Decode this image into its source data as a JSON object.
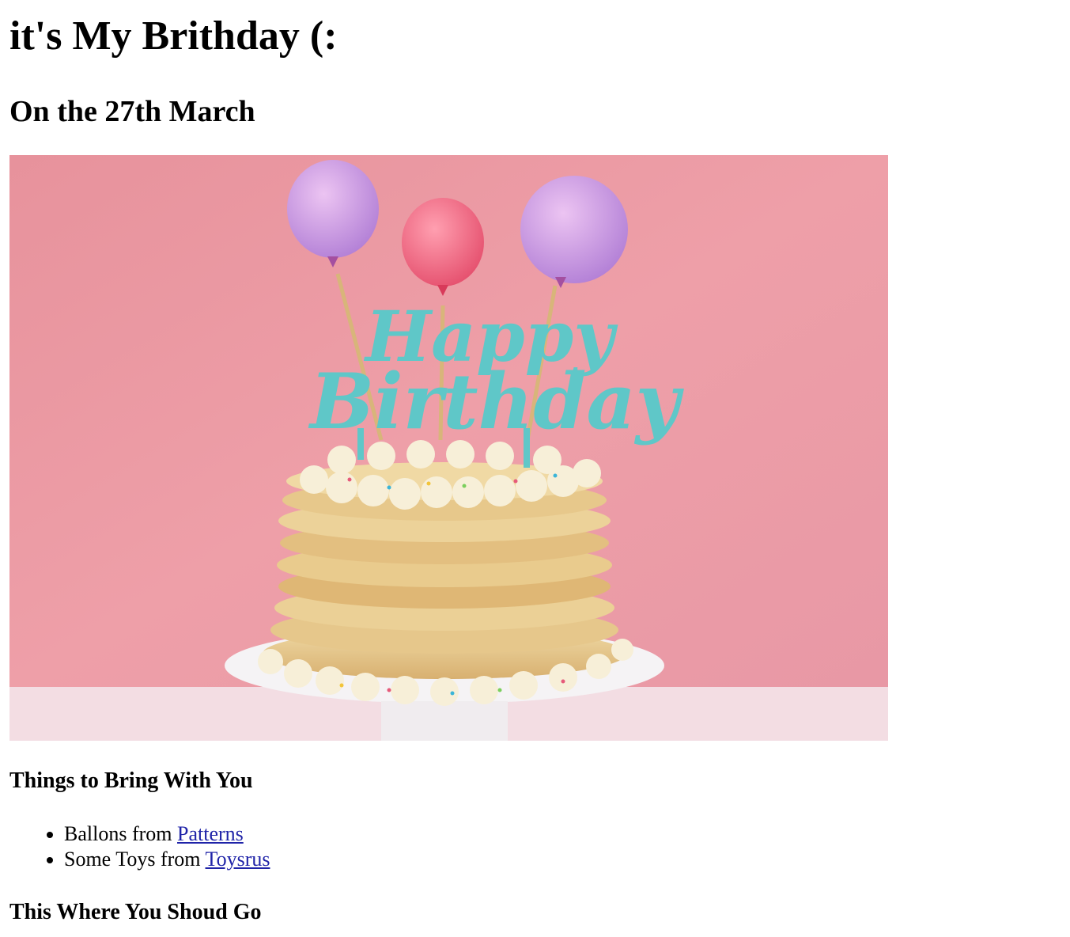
{
  "page": {
    "title": "it's My Brithday (:",
    "subtitle": "On the 27th March"
  },
  "hero_image": {
    "description_label": "birthday-pancake-cake-image",
    "topper_text_line1": "Happy",
    "topper_text_line2": "Birthday",
    "colors": {
      "background": "#e99aa3",
      "balloon_purple": "#c79ae0",
      "balloon_pink": "#f0687f",
      "topper": "#5fc7c8",
      "pancake": "#e8c98a",
      "plate": "#f4f1f3"
    }
  },
  "bring_section": {
    "heading": "Things to Bring With You",
    "items": [
      {
        "text": "Ballons from ",
        "link": "Patterns"
      },
      {
        "text": "Some Toys from ",
        "link": "Toysrus"
      }
    ]
  },
  "where_section": {
    "heading": "This Where You Shoud Go"
  }
}
